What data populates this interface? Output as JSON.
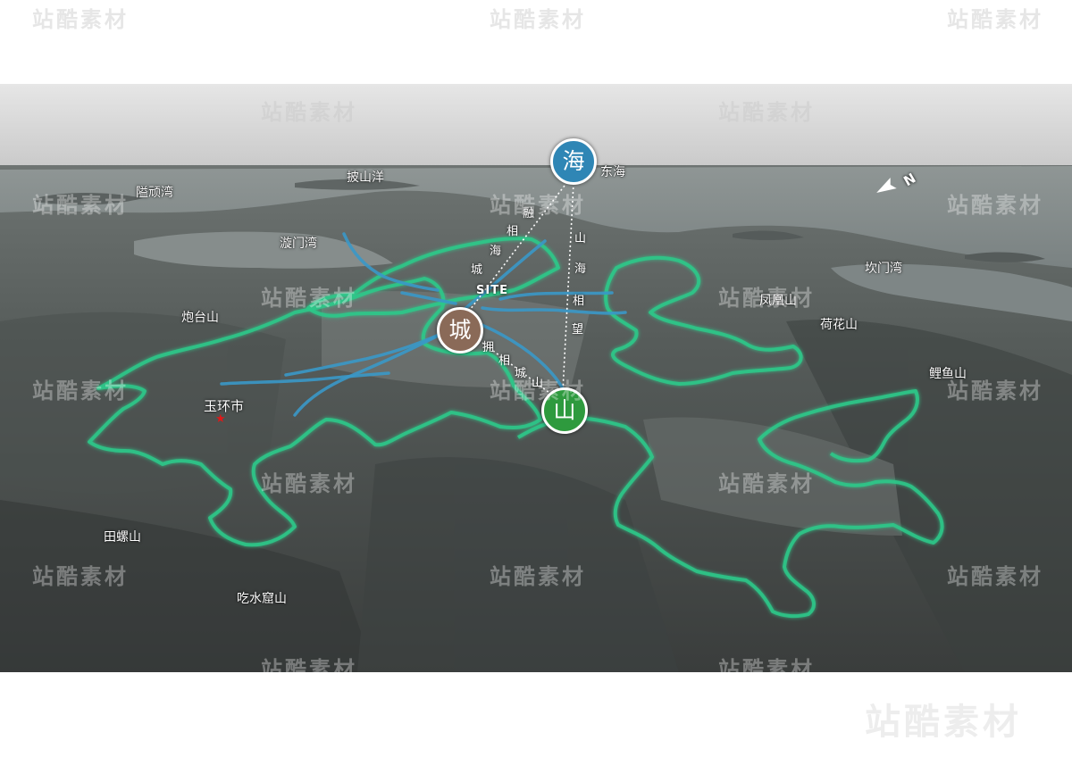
{
  "map": {
    "places": {
      "yihan_bay": "隘顽湾",
      "pishan_ocean": "披山洋",
      "xuanmen_bay": "漩门湾",
      "east_sea": "东海",
      "kanmen_bay": "坎门湾",
      "paotai_mountain": "炮台山",
      "fenghuang_mountain": "凤凰山",
      "hehua_mountain": "荷花山",
      "liyu_mountain": "鲤鱼山",
      "yuhuan_city": "玉环市",
      "tianluo_mountain": "田螺山",
      "chishuiku_mountain": "吃水窟山"
    },
    "site_label": "SITE",
    "north_label": "N",
    "badges": {
      "sea": "海",
      "city": "城",
      "mountain": "山"
    },
    "badge_colors": {
      "sea": "#2f86b5",
      "city": "#8a6a58",
      "mountain": "#2e9a3e"
    },
    "phrases": {
      "sea_city": [
        "融",
        "相",
        "海",
        "城"
      ],
      "mountain_sea": [
        "山",
        "海",
        "相",
        "望"
      ],
      "city_mountain": [
        "拥",
        "相",
        "城",
        "山"
      ]
    },
    "watermark": "站酷素材",
    "colors": {
      "mountain_outline": "#2dc98a",
      "river": "#3a98c8",
      "marker": "#e01818"
    }
  }
}
